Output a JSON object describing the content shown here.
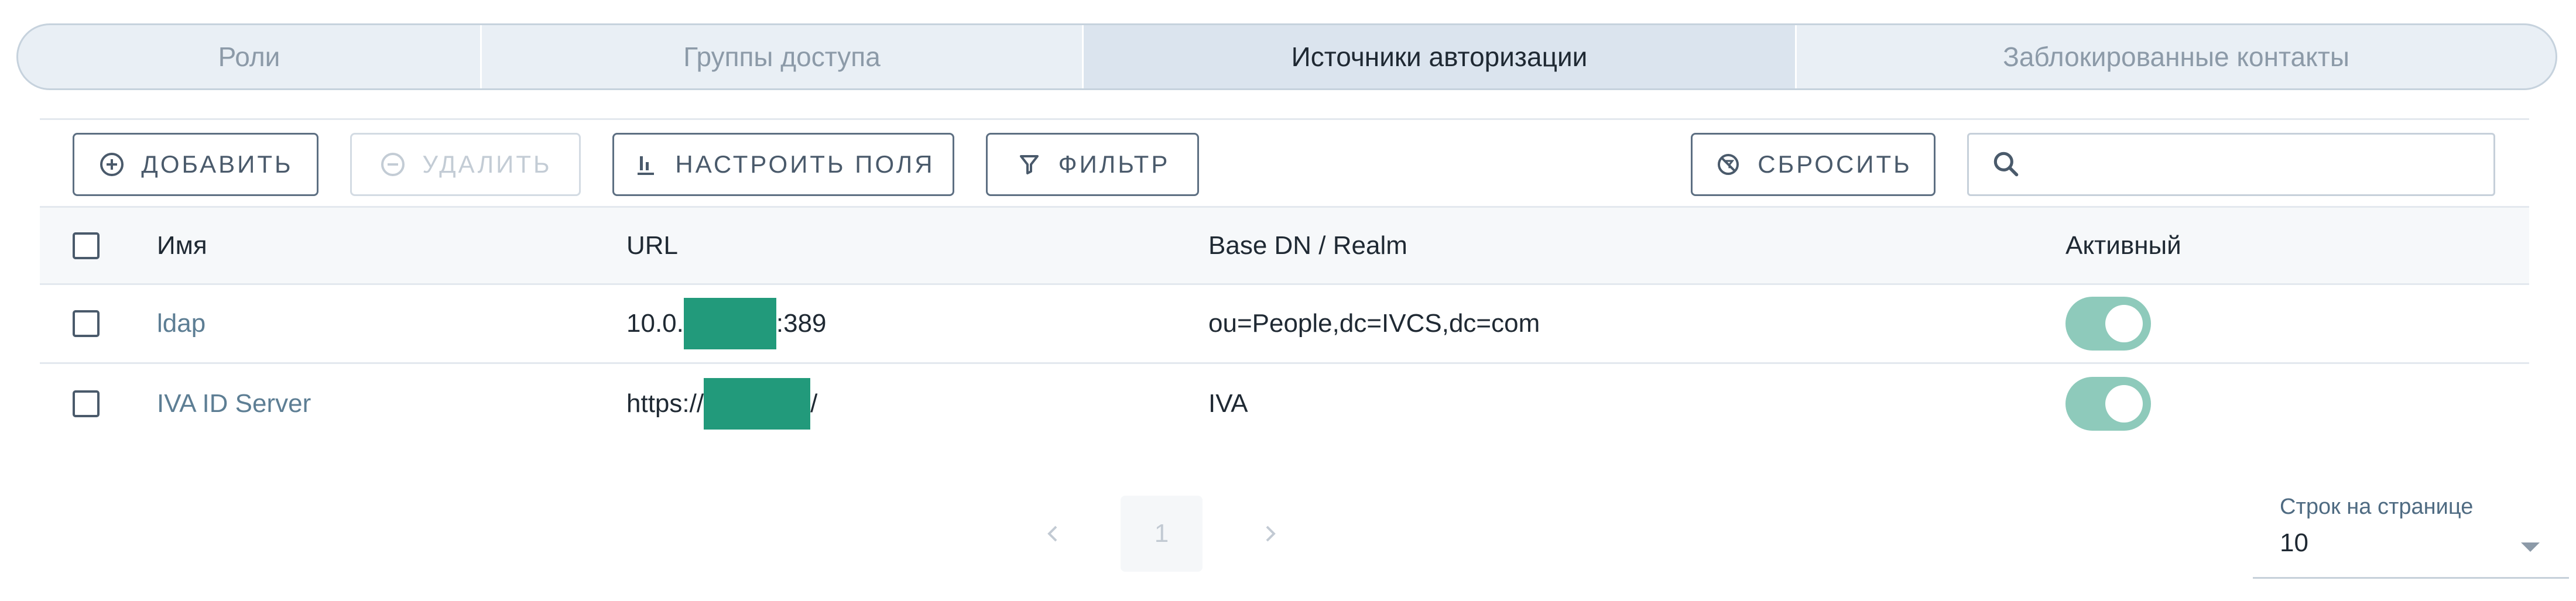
{
  "tabs": [
    {
      "label": "Роли",
      "active": false
    },
    {
      "label": "Группы доступа",
      "active": false
    },
    {
      "label": "Источники авторизации",
      "active": true
    },
    {
      "label": "Заблокированные контакты",
      "active": false
    }
  ],
  "toolbar": {
    "add_label": "Добавить",
    "delete_label": "Удалить",
    "fields_label": "Настроить поля",
    "filter_label": "Фильтр",
    "reset_label": "Сбросить",
    "search_placeholder": ""
  },
  "table": {
    "columns": [
      "Имя",
      "URL",
      "Base DN / Realm",
      "Активный"
    ],
    "rows": [
      {
        "name": "ldap",
        "url_prefix": "10.0.",
        "url_suffix": ":389",
        "base_dn": "ou=People,dc=IVCS,dc=com",
        "active": true
      },
      {
        "name": "IVA ID Server",
        "url_prefix": "https://",
        "url_suffix": "/",
        "base_dn": "IVA",
        "active": true
      }
    ]
  },
  "pagination": {
    "current_page": "1",
    "rows_per_page_label": "Строк на странице",
    "rows_per_page": "10"
  },
  "colors": {
    "accent": "#229a7b",
    "toggle_on": "#8ecabb",
    "link": "#5d7e94"
  }
}
